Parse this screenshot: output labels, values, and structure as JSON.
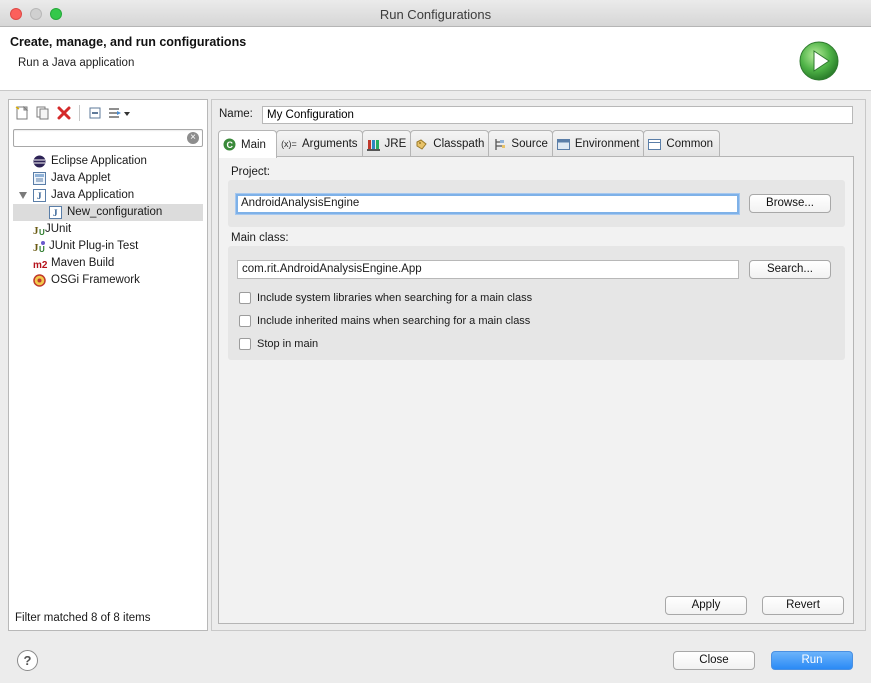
{
  "window": {
    "title": "Run Configurations"
  },
  "banner": {
    "title": "Create, manage, and run configurations",
    "subtitle": "Run a Java application",
    "icon": "run-icon"
  },
  "left": {
    "toolbar": [
      {
        "icon": "new-configuration-icon"
      },
      {
        "icon": "duplicate-icon"
      },
      {
        "icon": "delete-icon"
      },
      {
        "icon": "collapse-all-icon"
      },
      {
        "icon": "filter-icon"
      }
    ],
    "filter_placeholder": "",
    "tree": [
      {
        "label": "Eclipse Application",
        "icon": "eclipse-icon"
      },
      {
        "label": "Java Applet",
        "icon": "java-applet-icon"
      },
      {
        "label": "Java Application",
        "icon": "java-application-icon"
      },
      {
        "label": "New_configuration",
        "icon": "java-application-icon"
      },
      {
        "label": "JUnit",
        "icon": "junit-icon"
      },
      {
        "label": "JUnit Plug-in Test",
        "icon": "junit-plugin-icon"
      },
      {
        "label": "Maven Build",
        "icon": "maven-icon"
      },
      {
        "label": "OSGi Framework",
        "icon": "osgi-icon"
      }
    ],
    "status": "Filter matched 8 of 8 items"
  },
  "config": {
    "name_label": "Name:",
    "name_value": "My Configuration",
    "tabs": [
      {
        "label": "Main",
        "icon": "main-class-icon"
      },
      {
        "label": "Arguments",
        "icon": "arguments-icon"
      },
      {
        "label": "JRE",
        "icon": "jre-icon"
      },
      {
        "label": "Classpath",
        "icon": "classpath-icon"
      },
      {
        "label": "Source",
        "icon": "source-icon"
      },
      {
        "label": "Environment",
        "icon": "environment-icon"
      },
      {
        "label": "Common",
        "icon": "common-icon"
      }
    ],
    "project_label": "Project:",
    "project_value": "AndroidAnalysisEngine",
    "browse_label": "Browse...",
    "main_class_label": "Main class:",
    "main_class_value": "com.rit.AndroidAnalysisEngine.App",
    "search_label": "Search...",
    "checks": [
      "Include system libraries when searching for a main class",
      "Include inherited mains when searching for a main class",
      "Stop in main"
    ],
    "apply_label": "Apply",
    "revert_label": "Revert"
  },
  "footer": {
    "help": "?",
    "close_label": "Close",
    "run_label": "Run"
  },
  "colors": {
    "primary_button": "#2a8af6",
    "focus_ring": "#7eb1e8",
    "run_icon": "#3aa63a"
  }
}
